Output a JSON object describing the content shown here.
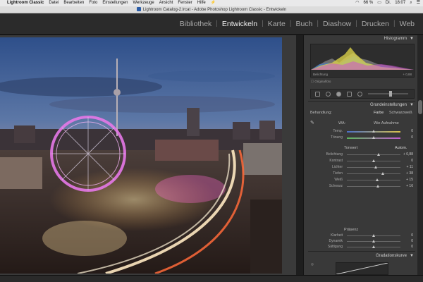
{
  "menubar": {
    "apple": "",
    "items": [
      "Lightroom Classic",
      "Datei",
      "Bearbeiten",
      "Foto",
      "Einstellungen",
      "Werkzeuge",
      "Ansicht",
      "Fenster",
      "Hilfe"
    ],
    "status_battery": "66 %",
    "status_day": "Di.",
    "status_time": "18:07"
  },
  "window": {
    "title": "Lightroom Catalog-2.lrcat - Adobe Photoshop Lightroom Classic - Entwickeln"
  },
  "modules": [
    "Bibliothek",
    "Entwickeln",
    "Karte",
    "Buch",
    "Diashow",
    "Drucken",
    "Web"
  ],
  "active_module": "Entwickeln",
  "panel": {
    "histogram_title": "Histogramm",
    "histogram_left": "Belichtung",
    "histogram_right": "+ 0,88",
    "original_photo": "Originalfoto",
    "basic_title": "Grundeinstellungen",
    "treatment_label": "Behandlung:",
    "treatment_color": "Farbe",
    "treatment_bw": "Schwarzweiß",
    "wb_label": "WA:",
    "wb_value": "Wie Aufnahme",
    "temp_label": "Temp.",
    "temp_value": "0",
    "tint_label": "Tönung",
    "tint_value": "0",
    "tone_label": "Tonwert",
    "tone_auto": "Autom.",
    "rows": [
      {
        "label": "Belichtung",
        "value": "+ 0,88",
        "pos": 0.6
      },
      {
        "label": "Kontrast",
        "value": "0",
        "pos": 0.5
      },
      {
        "label": "Lichter",
        "value": "+ 11",
        "pos": 0.55
      },
      {
        "label": "Tiefen",
        "value": "+ 38",
        "pos": 0.68
      },
      {
        "label": "Weiß",
        "value": "+ 15",
        "pos": 0.57
      },
      {
        "label": "Schwarz",
        "value": "+ 16",
        "pos": 0.58
      }
    ],
    "presence_label": "Präsenz",
    "presence_rows": [
      {
        "label": "Klarheit",
        "value": "0",
        "pos": 0.5
      },
      {
        "label": "Dynamik",
        "value": "0",
        "pos": 0.5
      },
      {
        "label": "Sättigung",
        "value": "0",
        "pos": 0.5
      }
    ],
    "curve_title": "Gradationskurve"
  },
  "colors": {
    "accent_active": "#f2f2f2",
    "panel_bg": "#393939",
    "module_bar": "#2b2b2b"
  }
}
